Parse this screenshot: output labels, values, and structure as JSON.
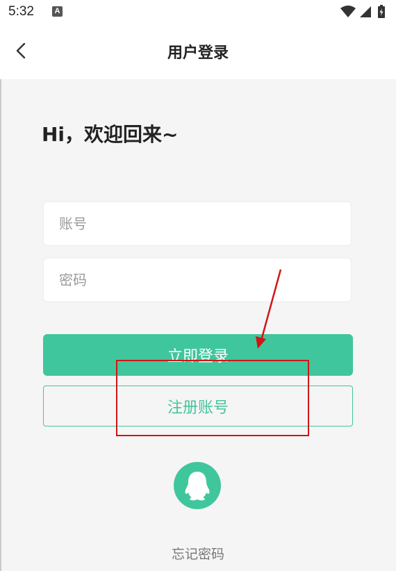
{
  "status_bar": {
    "time": "5:32",
    "notification_icon_letter": "A",
    "icons": [
      "wifi-icon",
      "signal-icon",
      "battery-charging-icon"
    ]
  },
  "nav": {
    "back_icon": "chevron-left-icon",
    "title": "用户登录"
  },
  "welcome_text": "Hi，欢迎回来~",
  "form": {
    "account_placeholder": "账号",
    "account_value": "",
    "password_placeholder": "密码",
    "password_value": ""
  },
  "buttons": {
    "login_label": "立即登录",
    "register_label": "注册账号"
  },
  "social": {
    "qq_icon": "qq-penguin-icon"
  },
  "forgot_password": "忘记密码",
  "colors": {
    "accent": "#40c69c",
    "background": "#f5f5f5",
    "annotation": "#d01515"
  }
}
